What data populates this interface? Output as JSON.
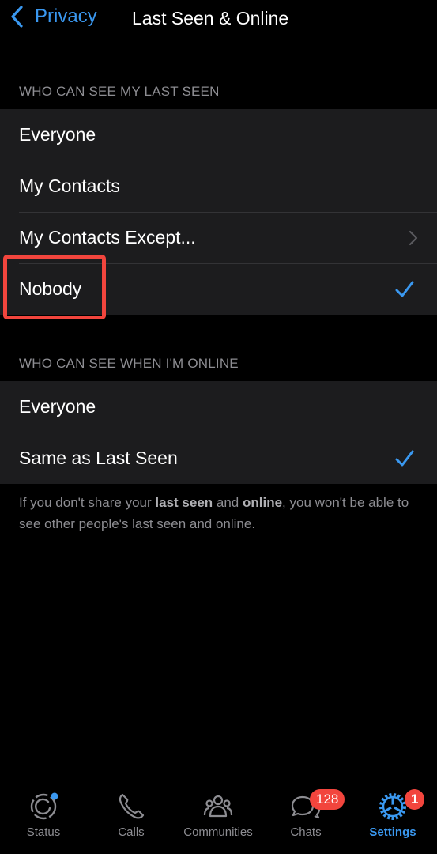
{
  "nav": {
    "back_label": "Privacy",
    "title": "Last Seen & Online"
  },
  "last_seen": {
    "header": "WHO CAN SEE MY LAST SEEN",
    "options": [
      {
        "label": "Everyone",
        "selected": false
      },
      {
        "label": "My Contacts",
        "selected": false
      },
      {
        "label": "My Contacts Except...",
        "selected": false,
        "has_chevron": true
      },
      {
        "label": "Nobody",
        "selected": true,
        "highlighted": true
      }
    ]
  },
  "online": {
    "header": "WHO CAN SEE WHEN I'M ONLINE",
    "options": [
      {
        "label": "Everyone",
        "selected": false
      },
      {
        "label": "Same as Last Seen",
        "selected": true
      }
    ]
  },
  "footer": {
    "part1": "If you don't share your ",
    "bold1": "last seen",
    "part2": " and ",
    "bold2": "online",
    "part3": ", you won't be able to see other people's last seen and online."
  },
  "tabbar": {
    "tabs": [
      {
        "label": "Status",
        "icon": "status-icon",
        "dot": true
      },
      {
        "label": "Calls",
        "icon": "phone-icon"
      },
      {
        "label": "Communities",
        "icon": "communities-icon"
      },
      {
        "label": "Chats",
        "icon": "chats-icon",
        "badge": "128"
      },
      {
        "label": "Settings",
        "icon": "gear-icon",
        "badge": "1",
        "active": true
      }
    ]
  },
  "colors": {
    "accent": "#3a98f0",
    "highlight": "#f2453d",
    "badge": "#f2453d"
  }
}
